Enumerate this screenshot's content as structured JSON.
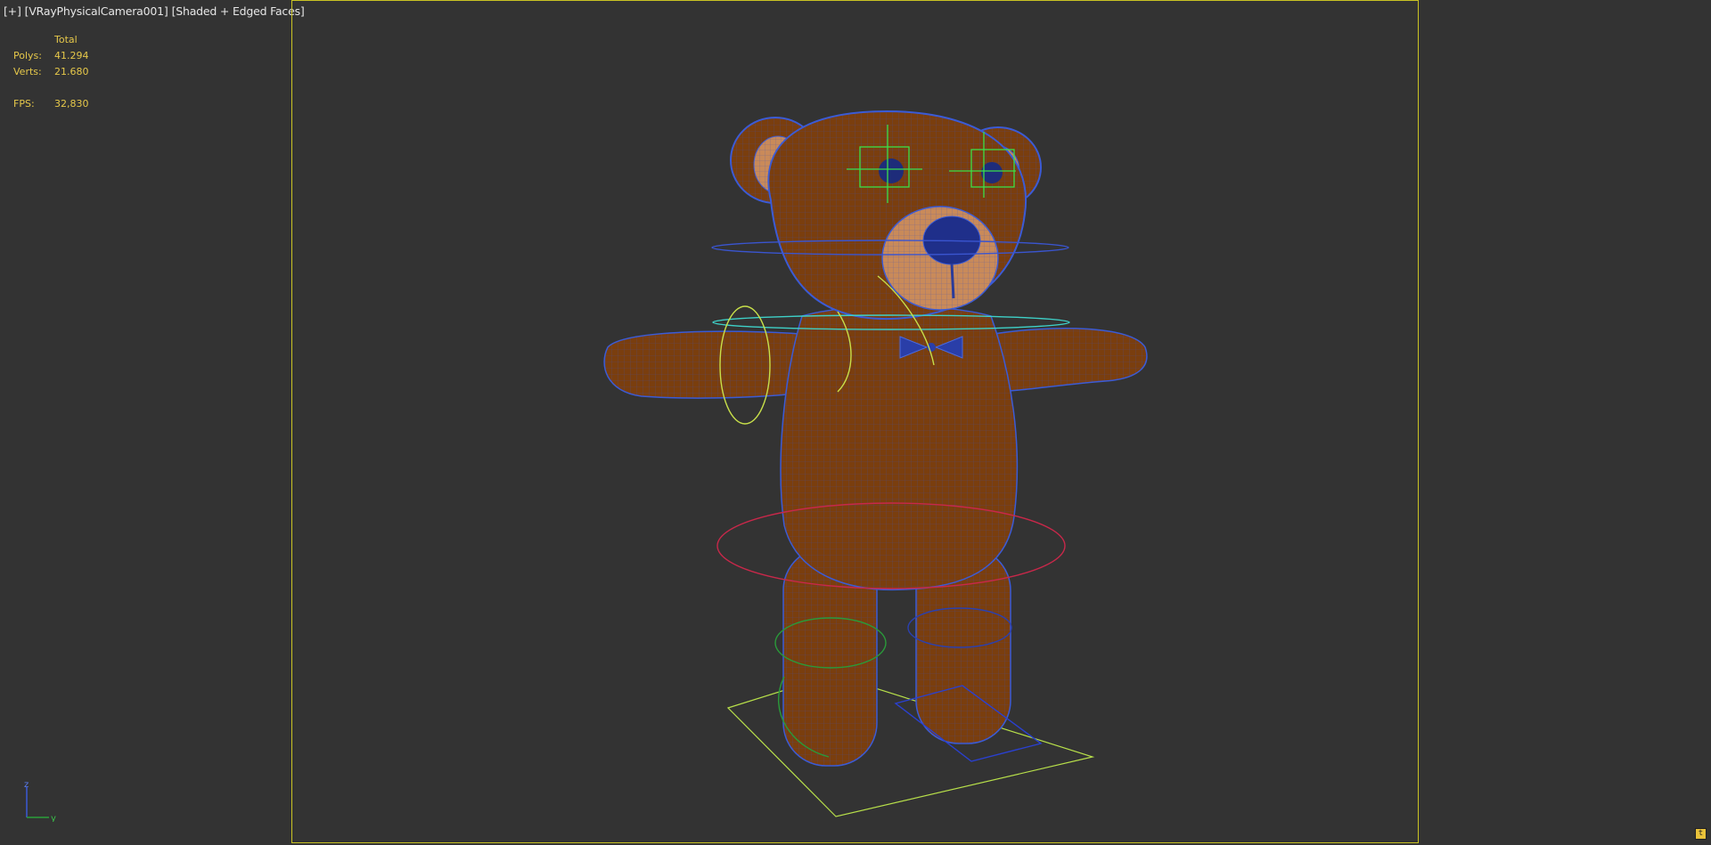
{
  "viewport": {
    "menu_plus": "[+]",
    "camera": "[VRayPhysicalCamera001]",
    "shading": "[Shaded + Edged Faces]"
  },
  "stats": {
    "header": "Total",
    "polys_label": "Polys:",
    "polys_value": "41.294",
    "verts_label": "Verts:",
    "verts_value": "21.680",
    "fps_label": "FPS:",
    "fps_value": "32,830"
  },
  "axis": {
    "x": "y",
    "z": "z"
  },
  "corner_icon": "t",
  "colors": {
    "background": "#333333",
    "safe_frame": "#c9c323",
    "stats_text": "#e6c84a",
    "bear_fill": "#7a3e0e",
    "wire": "#3b5bd6"
  }
}
